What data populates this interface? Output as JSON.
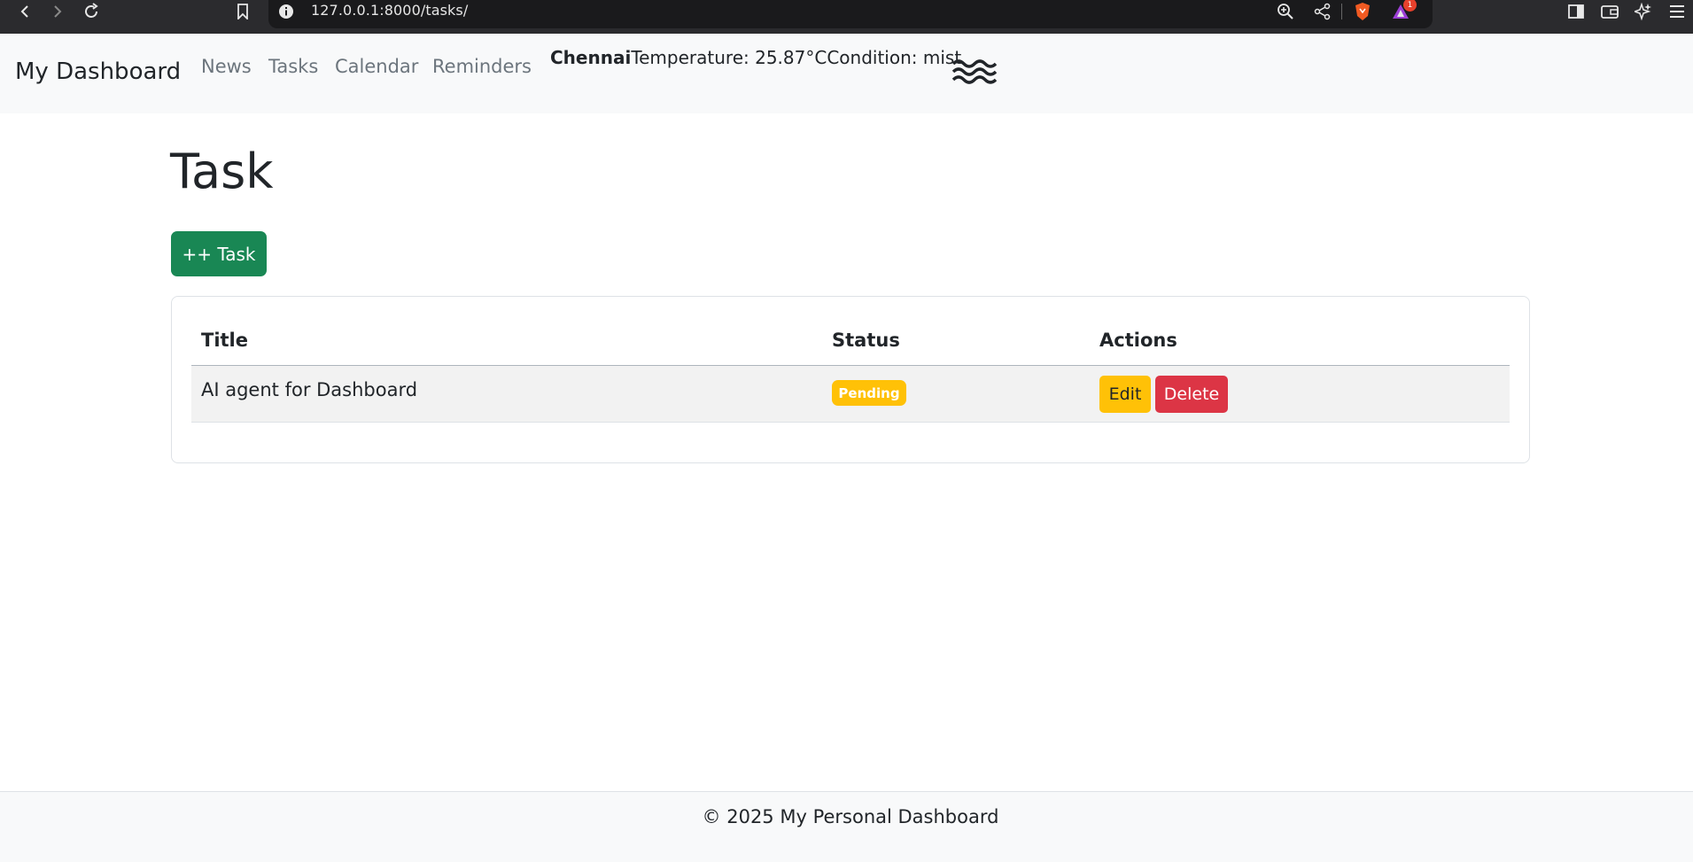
{
  "browser": {
    "url": "127.0.0.1:8000/tasks/",
    "notification_count": "1",
    "icons": [
      "back-icon",
      "forward-icon",
      "reload-icon",
      "bookmark-icon",
      "info-icon",
      "zoom-icon",
      "share-icon",
      "brave-shield-icon",
      "rewards-icon",
      "sidebar-icon",
      "wallet-icon",
      "leo-icon",
      "menu-icon"
    ]
  },
  "navbar": {
    "brand": "My Dashboard",
    "links": [
      "News",
      "Tasks",
      "Calendar",
      "Reminders"
    ],
    "weather": {
      "city": "Chennai",
      "temperature": "Temperature: 25.87°C",
      "condition": "Condition: mist",
      "icon": "mist-icon"
    }
  },
  "main": {
    "title": "Task",
    "add_button": "++ Task",
    "table": {
      "columns": [
        "Title",
        "Status",
        "Actions"
      ],
      "rows": [
        {
          "title": "AI agent for Dashboard",
          "status": "Pending",
          "edit": "Edit",
          "delete": "Delete"
        }
      ]
    }
  },
  "footer": {
    "text": "© 2025 My Personal Dashboard"
  },
  "colors": {
    "success": "#198754",
    "warning": "#ffc107",
    "danger": "#dc3545",
    "navbar_bg": "#f8f9fa"
  }
}
